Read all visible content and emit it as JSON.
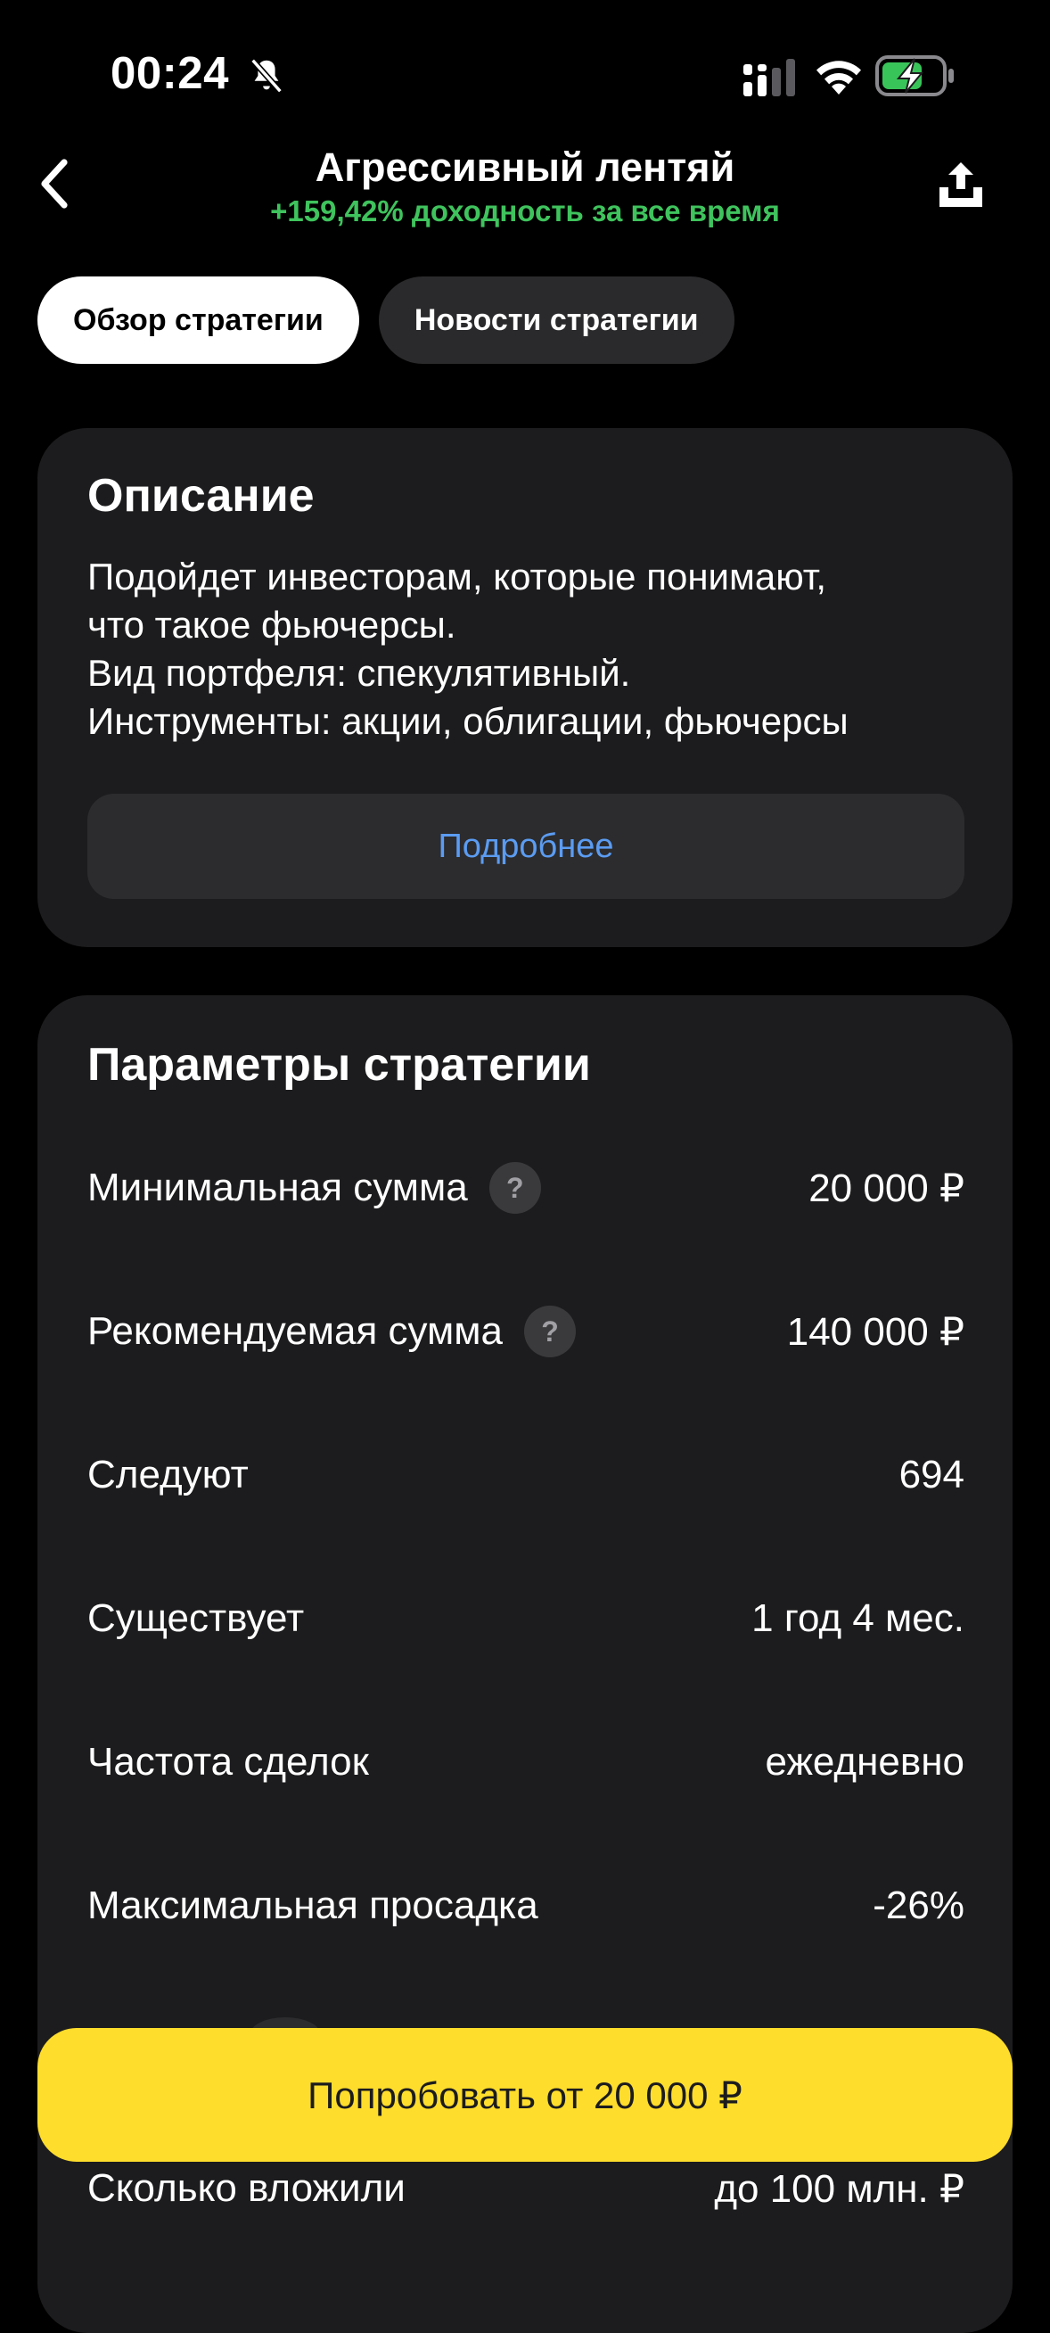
{
  "status_bar": {
    "time": "00:24"
  },
  "header": {
    "title": "Агрессивный лентяй",
    "subtitle": "+159,42% доходность за все время"
  },
  "tabs": [
    {
      "label": "Обзор стратегии",
      "active": true
    },
    {
      "label": "Новости стратегии",
      "active": false
    }
  ],
  "description": {
    "title": "Описание",
    "lines": [
      "Подойдет инвесторам, которые понимают,",
      "что такое фьючерсы.",
      "Вид портфеля: спекулятивный.",
      "Инструменты: акции, облигации, фьючерсы"
    ],
    "more_label": "Подробнее"
  },
  "params": {
    "title": "Параметры стратегии",
    "rows": [
      {
        "label": "Минимальная сумма",
        "value": "20 000 ₽",
        "help": "?"
      },
      {
        "label": "Рекомендуемая сумма",
        "value": "140 000 ₽",
        "help": "?"
      },
      {
        "label": "Следуют",
        "value": "694"
      },
      {
        "label": "Существует",
        "value": "1 год 4 мес."
      },
      {
        "label": "Частота сделок",
        "value": "ежедневно"
      },
      {
        "label": "Максимальная просадка",
        "value": "-26%"
      },
      {
        "label": "Сколько вложили",
        "value": "до 100 млн. ₽"
      }
    ]
  },
  "cta": {
    "label": "Попробовать от 20 000 ₽"
  },
  "colors": {
    "accent_green": "#3fc35d",
    "link_blue": "#5b9cf2",
    "cta_yellow": "#fedd2c",
    "card_bg": "#1c1c1e"
  }
}
